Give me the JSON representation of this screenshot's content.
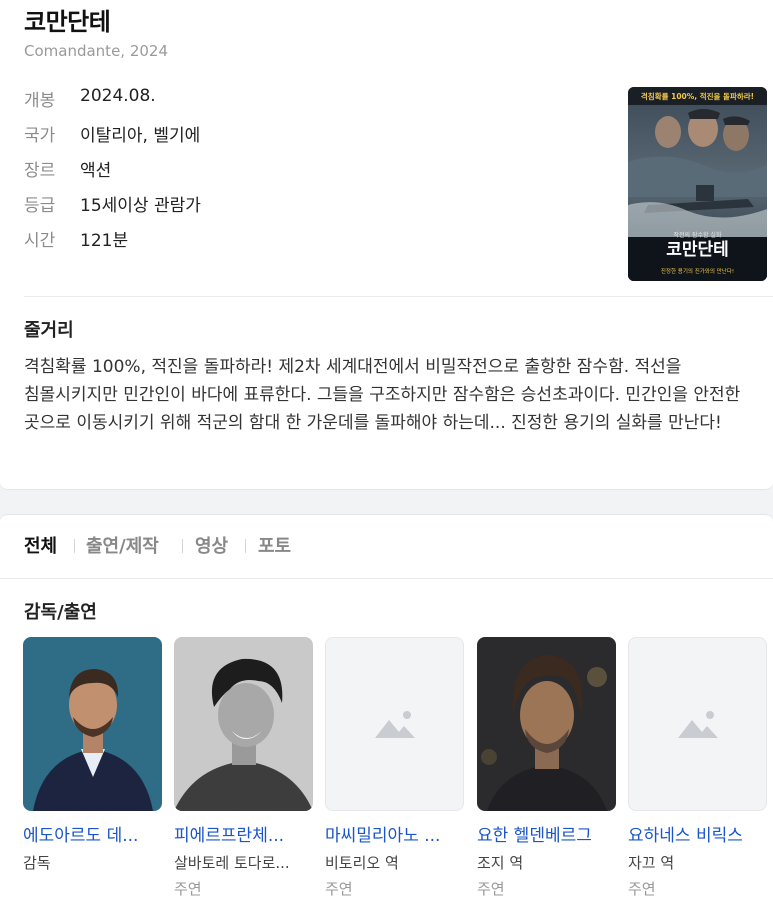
{
  "movie": {
    "title": "코만단테",
    "subtitle": "Comandante, 2024",
    "info": [
      {
        "label": "개봉",
        "value": "2024.08."
      },
      {
        "label": "국가",
        "value": "이탈리아, 벨기에"
      },
      {
        "label": "장르",
        "value": "액션"
      },
      {
        "label": "등급",
        "value": "15세이상 관람가"
      },
      {
        "label": "시간",
        "value": "121분"
      }
    ],
    "poster": {
      "tagline": "격침확률 100%, 적진을 돌파하라!",
      "small_text": "작전의 잠수함 실화",
      "title": "코만단테",
      "footer": "진정한 용기의 진가와의 만난다!"
    }
  },
  "synopsis": {
    "heading": "줄거리",
    "text": "격침확률 100%, 적진을 돌파하라! 제2차 세계대전에서 비밀작전으로 출항한 잠수함. 적선을 침몰시키지만 민간인이 바다에 표류한다. 그들을 구조하지만 잠수함은 승선초과이다. 민간인을 안전한 곳으로 이동시키기 위해 적군의 함대 한 가운데를 돌파해야 하는데... 진정한 용기의 실화를 만난다!"
  },
  "tabs": [
    {
      "label": "전체",
      "active": true
    },
    {
      "label": "출연/제작",
      "active": false
    },
    {
      "label": "영상",
      "active": false
    },
    {
      "label": "포토",
      "active": false
    }
  ],
  "cast": {
    "heading": "감독/출연",
    "people": [
      {
        "name": "에도아르도 데...",
        "role": "감독",
        "type": "",
        "photo": "photo"
      },
      {
        "name": "피에르프란체...",
        "role": "살바토레 토다로...",
        "type": "주연",
        "photo": "photo"
      },
      {
        "name": "마씨밀리아노 ...",
        "role": "비토리오 역",
        "type": "주연",
        "photo": "placeholder"
      },
      {
        "name": "요한 헬덴베르그",
        "role": "조지 역",
        "type": "주연",
        "photo": "photo"
      },
      {
        "name": "요하네스 비릭스",
        "role": "자끄 역",
        "type": "주연",
        "photo": "placeholder"
      }
    ]
  }
}
